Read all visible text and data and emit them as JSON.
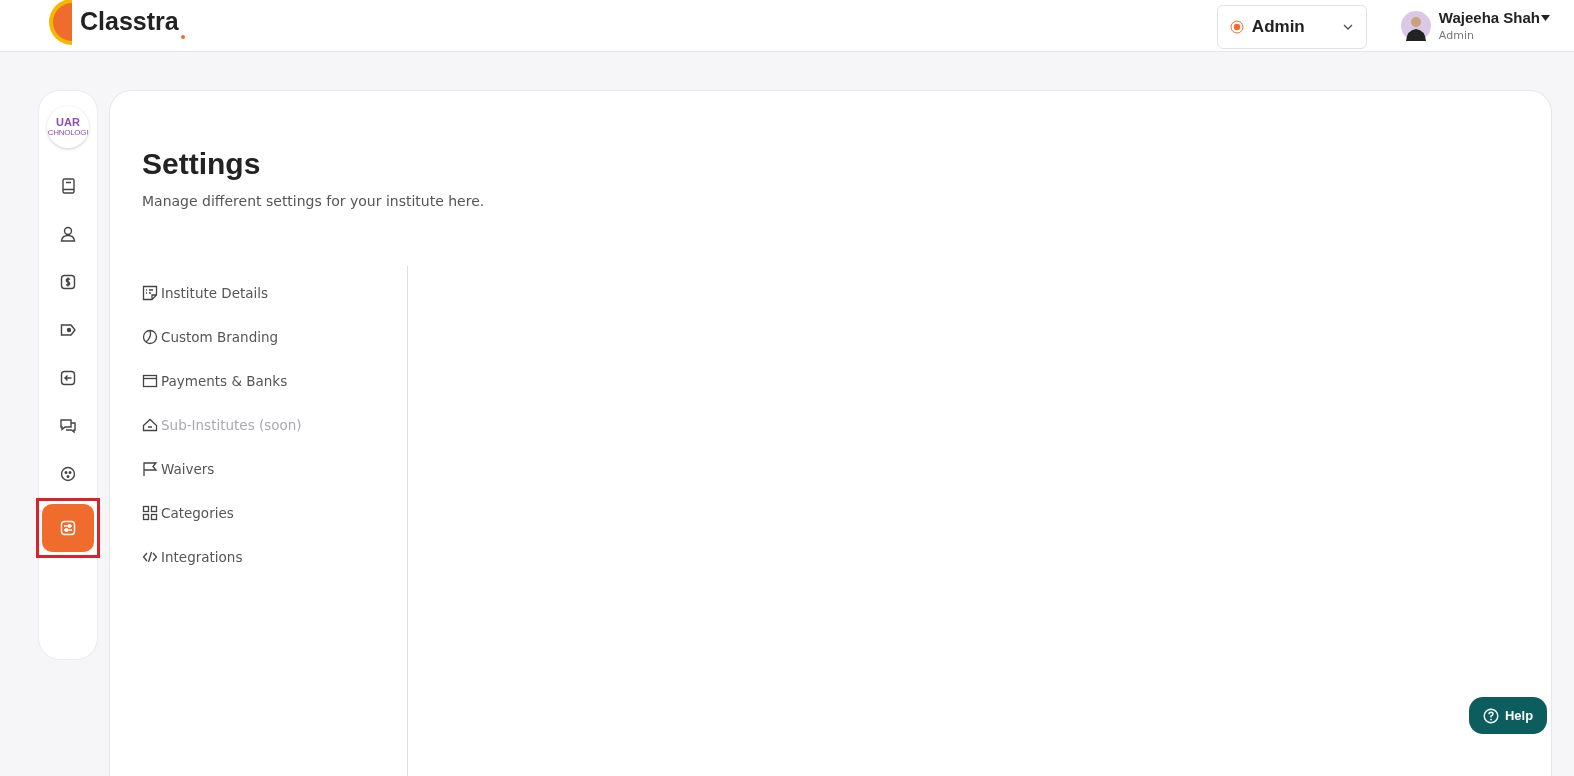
{
  "header": {
    "brand": "Classtra",
    "role_select": {
      "value": "Admin"
    },
    "user": {
      "name": "Wajeeha Shah",
      "role": "Admin"
    }
  },
  "sidebar": {
    "logo": {
      "line_1": "UAR",
      "line_2": "CHNOLOGI"
    },
    "items": [
      {
        "selected": false
      },
      {
        "selected": false
      },
      {
        "selected": false
      },
      {
        "selected": false
      },
      {
        "selected": false
      },
      {
        "selected": false
      },
      {
        "selected": false
      },
      {
        "selected": true,
        "highlighted": true
      }
    ]
  },
  "page": {
    "title": "Settings",
    "subtitle": "Manage different settings for your institute here."
  },
  "settings_menu": [
    {
      "label": "Institute Details",
      "disabled": false
    },
    {
      "label": "Custom Branding",
      "disabled": false
    },
    {
      "label": "Payments & Banks",
      "disabled": false
    },
    {
      "label": "Sub-Institutes (soon)",
      "disabled": true
    },
    {
      "label": "Waivers",
      "disabled": false
    },
    {
      "label": "Categories",
      "disabled": false
    },
    {
      "label": "Integrations",
      "disabled": false
    }
  ],
  "help_button": {
    "label": "Help"
  }
}
